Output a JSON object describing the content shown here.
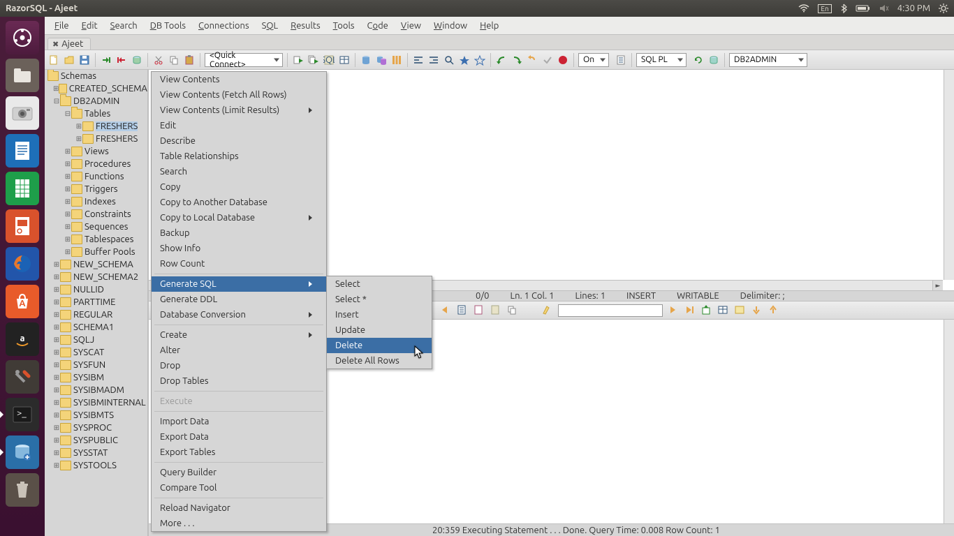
{
  "topbar": {
    "title": "RazorSQL - Ajeet",
    "lang": "En",
    "time": "4:30 PM"
  },
  "menubar": [
    {
      "label": "File",
      "ul": "F"
    },
    {
      "label": "Edit",
      "ul": "E"
    },
    {
      "label": "Search",
      "ul": "S"
    },
    {
      "label": "DB Tools",
      "ul": "D"
    },
    {
      "label": "Connections",
      "ul": "C"
    },
    {
      "label": "SQL",
      "ul": "Q"
    },
    {
      "label": "Results",
      "ul": "R"
    },
    {
      "label": "Tools",
      "ul": "T"
    },
    {
      "label": "Code",
      "ul": "o"
    },
    {
      "label": "View",
      "ul": "V"
    },
    {
      "label": "Window",
      "ul": "W"
    },
    {
      "label": "Help",
      "ul": "H"
    }
  ],
  "tab": {
    "label": "Ajeet"
  },
  "toolbar": {
    "quick_connect": "<Quick Connect>",
    "on": "On",
    "lang": "SQL PL",
    "schema": "DB2ADMIN"
  },
  "tree": {
    "root": "Schemas",
    "items": [
      {
        "d": 1,
        "tw": "+",
        "label": "CREATED_SCHEMA"
      },
      {
        "d": 1,
        "tw": "-",
        "open": true,
        "label": "DB2ADMIN",
        "children": [
          {
            "d": 2,
            "tw": "-",
            "open": true,
            "label": "Tables",
            "children": [
              {
                "d": 3,
                "tw": "+",
                "sel": true,
                "label": "FRESHERS"
              },
              {
                "d": 3,
                "tw": "+",
                "label": "FRESHERS"
              }
            ]
          },
          {
            "d": 2,
            "tw": "+",
            "label": "Views"
          },
          {
            "d": 2,
            "tw": "+",
            "label": "Procedures"
          },
          {
            "d": 2,
            "tw": "+",
            "label": "Functions"
          },
          {
            "d": 2,
            "tw": "+",
            "label": "Triggers"
          },
          {
            "d": 2,
            "tw": "+",
            "label": "Indexes"
          },
          {
            "d": 2,
            "tw": "+",
            "label": "Constraints"
          },
          {
            "d": 2,
            "tw": "+",
            "label": "Sequences"
          },
          {
            "d": 2,
            "tw": "+",
            "label": "Tablespaces"
          },
          {
            "d": 2,
            "tw": "+",
            "label": "Buffer Pools"
          }
        ]
      },
      {
        "d": 1,
        "tw": "+",
        "label": "NEW_SCHEMA"
      },
      {
        "d": 1,
        "tw": "+",
        "label": "NEW_SCHEMA2"
      },
      {
        "d": 1,
        "tw": "+",
        "label": "NULLID"
      },
      {
        "d": 1,
        "tw": "+",
        "label": "PARTTIME"
      },
      {
        "d": 1,
        "tw": "+",
        "label": "REGULAR"
      },
      {
        "d": 1,
        "tw": "+",
        "label": "SCHEMA1"
      },
      {
        "d": 1,
        "tw": "+",
        "label": "SQLJ"
      },
      {
        "d": 1,
        "tw": "+",
        "label": "SYSCAT"
      },
      {
        "d": 1,
        "tw": "+",
        "label": "SYSFUN"
      },
      {
        "d": 1,
        "tw": "+",
        "label": "SYSIBM"
      },
      {
        "d": 1,
        "tw": "+",
        "label": "SYSIBMADM"
      },
      {
        "d": 1,
        "tw": "+",
        "label": "SYSIBMINTERNAL"
      },
      {
        "d": 1,
        "tw": "+",
        "label": "SYSIBMTS"
      },
      {
        "d": 1,
        "tw": "+",
        "label": "SYSPROC"
      },
      {
        "d": 1,
        "tw": "+",
        "label": "SYSPUBLIC"
      },
      {
        "d": 1,
        "tw": "+",
        "label": "SYSSTAT"
      },
      {
        "d": 1,
        "tw": "+",
        "label": "SYSTOOLS"
      }
    ]
  },
  "status1": {
    "pos": "0/0",
    "lncol": "Ln. 1 Col. 1",
    "lines": "Lines: 1",
    "mode": "INSERT",
    "writable": "WRITABLE",
    "delim": "Delimiter: ;"
  },
  "statusbar": {
    "text": "20:359 Executing Statement . . . Done.  Query Time: 0.008   Row Count: 1"
  },
  "ctx": [
    {
      "label": "View Contents"
    },
    {
      "label": "View Contents (Fetch All Rows)"
    },
    {
      "label": "View Contents (Limit Results)",
      "sub": true
    },
    {
      "label": "Edit"
    },
    {
      "label": "Describe"
    },
    {
      "label": "Table Relationships"
    },
    {
      "label": "Search"
    },
    {
      "label": "Copy"
    },
    {
      "label": "Copy to Another Database"
    },
    {
      "label": "Copy to Local Database",
      "sub": true
    },
    {
      "label": "Backup"
    },
    {
      "label": "Show Info"
    },
    {
      "label": "Row Count"
    },
    {
      "div": true
    },
    {
      "label": "Generate SQL",
      "sub": true,
      "hi": true
    },
    {
      "label": "Generate DDL"
    },
    {
      "label": "Database Conversion",
      "sub": true
    },
    {
      "div": true
    },
    {
      "label": "Create",
      "sub": true
    },
    {
      "label": "Alter"
    },
    {
      "label": "Drop"
    },
    {
      "label": "Drop Tables"
    },
    {
      "div": true
    },
    {
      "label": "Execute",
      "dis": true
    },
    {
      "div": true
    },
    {
      "label": "Import Data"
    },
    {
      "label": "Export Data"
    },
    {
      "label": "Export Tables"
    },
    {
      "div": true
    },
    {
      "label": "Query Builder"
    },
    {
      "label": "Compare Tool"
    },
    {
      "div": true
    },
    {
      "label": "Reload Navigator"
    },
    {
      "label": "More . . ."
    }
  ],
  "submenu": [
    {
      "label": "Select"
    },
    {
      "label": "Select *"
    },
    {
      "label": "Insert"
    },
    {
      "label": "Update"
    },
    {
      "label": "Delete",
      "hi": true
    },
    {
      "label": "Delete All Rows"
    }
  ]
}
